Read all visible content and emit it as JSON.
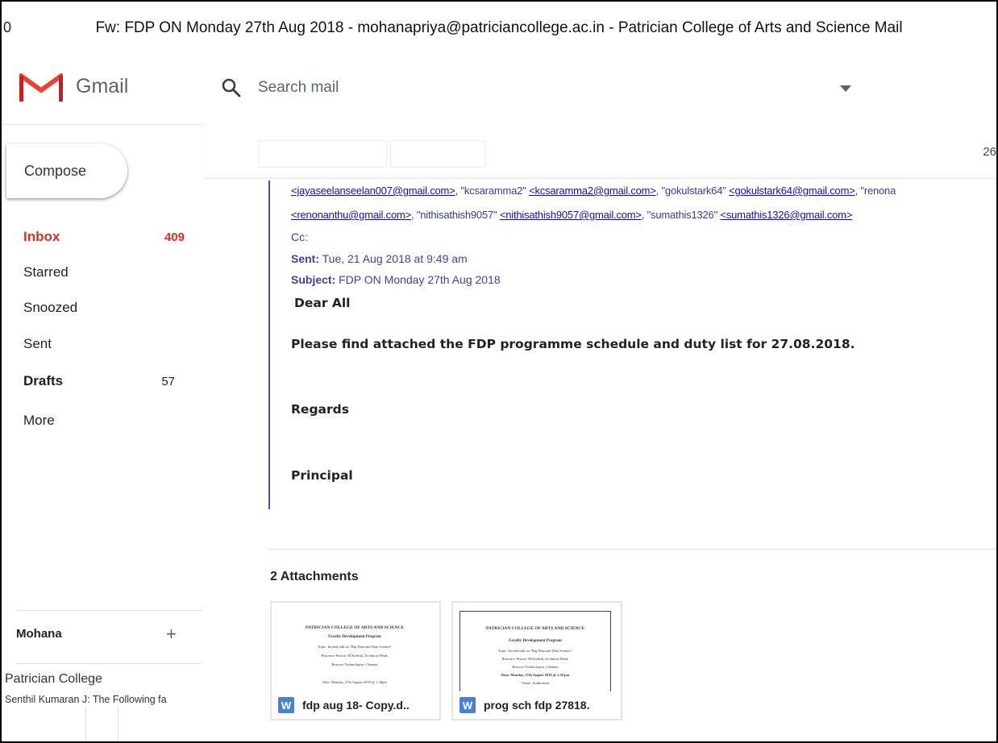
{
  "window": {
    "title_prefix": "0",
    "title": "Fw: FDP ON Monday 27th Aug 2018 - mohanapriya@patriciancollege.ac.in - Patrician College of Arts and Science Mail"
  },
  "header": {
    "app_name": "Gmail",
    "search_placeholder": "Search mail"
  },
  "sidebar": {
    "compose_label": "Compose",
    "items": [
      {
        "label": "Inbox",
        "count": "409"
      },
      {
        "label": "Starred",
        "count": ""
      },
      {
        "label": "Snoozed",
        "count": ""
      },
      {
        "label": "Sent",
        "count": ""
      },
      {
        "label": "Drafts",
        "count": "57"
      },
      {
        "label": "More",
        "count": ""
      }
    ]
  },
  "hangouts": {
    "user": "Mohana",
    "add_symbol": "+",
    "contact_name": "Patrician College",
    "contact_snippet": "Senthil Kumaran J: The Following fa"
  },
  "toolbar": {
    "page_count": "26"
  },
  "message": {
    "to_line1": [
      {
        "type": "link",
        "text": "<jayaseelanseelan007@gmail.com>"
      },
      {
        "type": "text",
        "text": ", \"kcsaramma2\" "
      },
      {
        "type": "link",
        "text": "<kcsaramma2@gmail.com>"
      },
      {
        "type": "text",
        "text": ", \"gokulstark64\" "
      },
      {
        "type": "link",
        "text": "<gokulstark64@gmail.com>"
      },
      {
        "type": "text",
        "text": ", \"renona"
      }
    ],
    "to_line2": [
      {
        "type": "link",
        "text": "<renonanthu@gmail.com>"
      },
      {
        "type": "text",
        "text": ", \"nithisathish9057\" "
      },
      {
        "type": "link",
        "text": "<nithisathish9057@gmail.com>"
      },
      {
        "type": "text",
        "text": ", \"sumathis1326\" "
      },
      {
        "type": "link",
        "text": "<sumathis1326@gmail.com>"
      }
    ],
    "cc_label": "Cc:",
    "sent_label": "Sent:",
    "sent_value": "Tue, 21 Aug 2018 at 9:49 am",
    "subject_label": "Subject:",
    "subject_value": "FDP ON  Monday 27th Aug 2018",
    "greeting": "Dear All",
    "body": "Please find attached the FDP programme schedule and duty list for 27.08.2018.",
    "regards": "Regards",
    "signature": "Principal"
  },
  "attachments": {
    "title": "2 Attachments",
    "items": [
      {
        "name": "fdp aug 18- Copy.d..",
        "icon": "W",
        "preview_lines": [
          "PATRICIAN COLLEGE OF ARTS AND SCIENCE",
          "Faculty Development Program",
          "Topic: Invited talk on \"Big Data and Data Science\"",
          "Resource Person: M.Karthik, Technical Head,",
          "Bosscoe Technologies, Chennai",
          "Date: Monday, 27th August 2018 @ 1.30pm"
        ]
      },
      {
        "name": "prog sch fdp 27818.",
        "icon": "W",
        "preview_lines": [
          "PATRICIAN COLLEGE OF ARTS AND SCIENCE",
          "Faculty Development Program",
          "Topic: Invited talk on \"Big Data and Data Science\"",
          "Resource Person: M.Karthik, Technical Head,",
          "Bosscoe Technologies, Chennai",
          "Date: Monday, 27th August 2018 @ 1.30 pm",
          "Venue: Auditorium"
        ]
      }
    ]
  },
  "colors": {
    "inbox_active": "#d93025",
    "quote_bar": "#5b4aa6",
    "link": "#1a0dab",
    "word_icon": "#4a7fd4"
  }
}
